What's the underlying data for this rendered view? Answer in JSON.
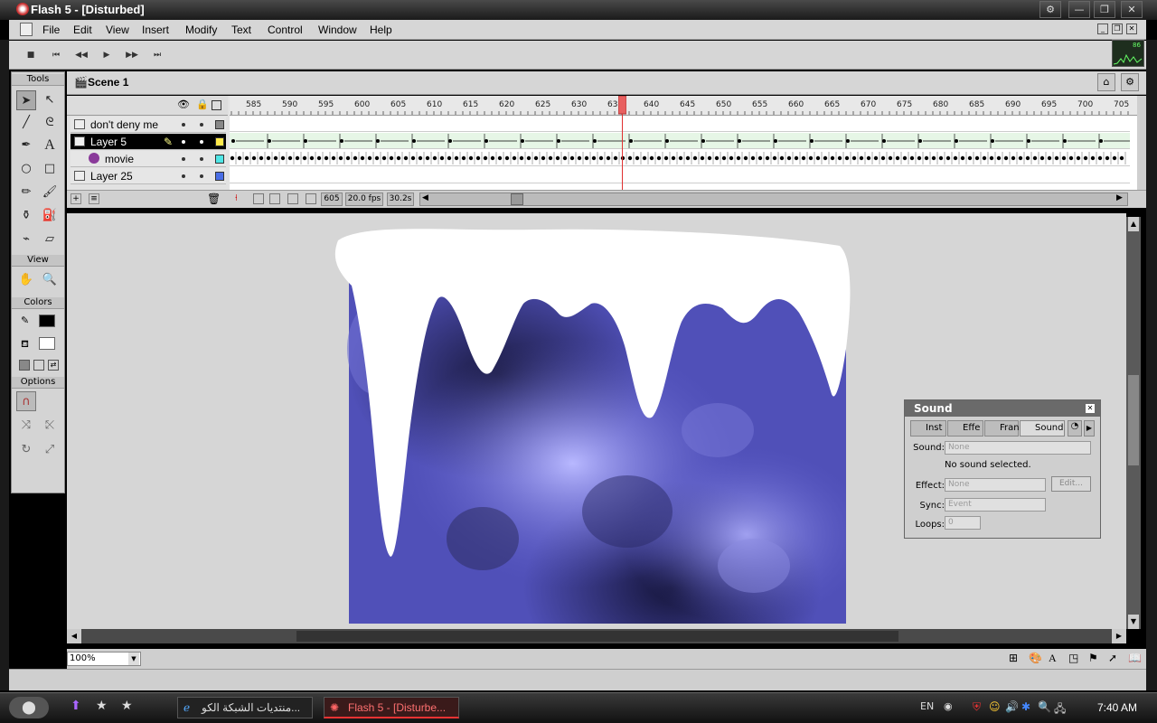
{
  "window": {
    "title": "Flash 5 - [Disturbed]"
  },
  "menubar": [
    "File",
    "Edit",
    "View",
    "Insert",
    "Modify",
    "Text",
    "Control",
    "Window",
    "Help"
  ],
  "graph_readout": "86",
  "toolbox": {
    "tools_label": "Tools",
    "view_label": "View",
    "colors_label": "Colors",
    "options_label": "Options"
  },
  "scene": {
    "name": "Scene 1"
  },
  "timeline": {
    "layers": [
      "don't deny me",
      "Layer 5",
      "movie",
      "Layer 25"
    ],
    "ruler_ticks": [
      "585",
      "590",
      "595",
      "600",
      "605",
      "610",
      "615",
      "620",
      "625",
      "630",
      "635",
      "640",
      "645",
      "650",
      "655",
      "660",
      "665",
      "670",
      "675",
      "680",
      "685",
      "690",
      "695",
      "700",
      "705"
    ],
    "current_frame": "605",
    "fps": "20.0 fps",
    "elapsed": "30.2s"
  },
  "zoom": "100%",
  "sound_panel": {
    "title": "Sound",
    "tabs": [
      "Inst",
      "Effe",
      "Fran",
      "Sound"
    ],
    "sound_label": "Sound:",
    "sound_value": "None",
    "no_sound": "No sound selected.",
    "effect_label": "Effect:",
    "effect_value": "None",
    "edit_button": "Edit...",
    "sync_label": "Sync:",
    "sync_value": "Event",
    "loops_label": "Loops:",
    "loops_value": "0"
  },
  "taskbar": {
    "tasks": [
      "منتديات الشبكة الكو...",
      "Flash 5 - [Disturbe..."
    ],
    "lang": "EN",
    "clock": "7:40 AM"
  },
  "colors": {
    "stage_blue": "#5a5ac8",
    "timeline_highlight": "#e86060"
  }
}
